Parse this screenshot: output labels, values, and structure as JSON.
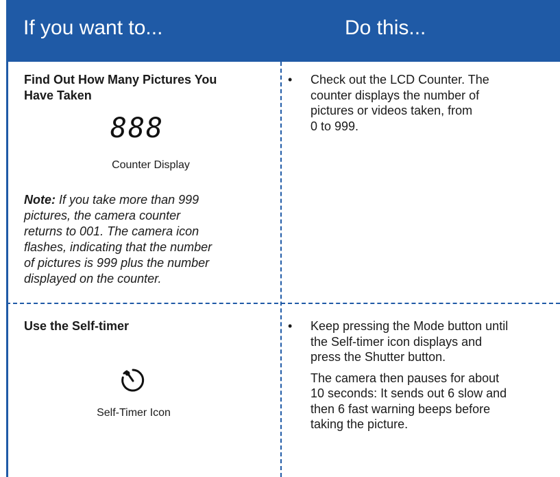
{
  "header": {
    "left_title": "If you want to...",
    "right_title": "Do this..."
  },
  "rows": [
    {
      "heading_line1": "Find Out How Many Pictures You",
      "heading_line2": "Have Taken",
      "counter_digits": "888",
      "caption": "Counter Display",
      "note_label": "Note:",
      "note_lines": [
        "If you take more than 999",
        "pictures, the camera counter",
        "returns to 001. The camera icon",
        "flashes, indicating that the number",
        "of pictures is 999 plus the number",
        "displayed on the counter."
      ],
      "bullet_lines": [
        "Check out the LCD Counter. The",
        "counter displays the number of",
        "pictures or videos taken, from",
        "0 to 999."
      ]
    },
    {
      "heading_line1": "Use the Self-timer",
      "icon": "self-timer-icon",
      "caption": "Self-Timer Icon",
      "bullet_lines": [
        "Keep pressing the Mode button until",
        "the Self-timer icon displays and",
        "press the Shutter button."
      ],
      "extra_lines": [
        "The camera then pauses for about",
        "10 seconds: It sends out 6 slow and",
        "then 6 fast warning beeps before",
        "taking the picture."
      ]
    }
  ],
  "colors": {
    "header_bg": "#1f5aa6",
    "header_text": "#ffffff",
    "divider": "#1f5aa6"
  }
}
